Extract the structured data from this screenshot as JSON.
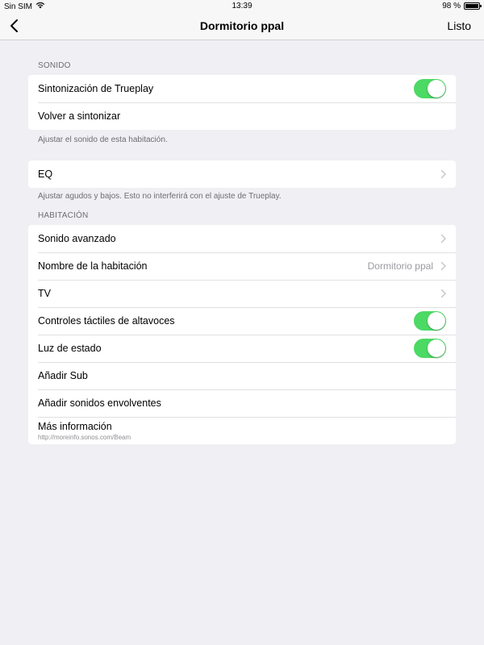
{
  "status_bar": {
    "carrier": "Sin SIM",
    "time": "13:39",
    "battery": "98 %",
    "battery_level": 0.98
  },
  "nav": {
    "title": "Dormitorio ppal",
    "done_label": "Listo"
  },
  "sound_section": {
    "header": "SONIDO",
    "trueplay_label": "Sintonización de Trueplay",
    "trueplay_on": true,
    "retune_label": "Volver a sintonizar",
    "footer": "Ajustar el sonido de esta habitación."
  },
  "eq_section": {
    "eq_label": "EQ",
    "footer": "Ajustar agudos y bajos. Esto no interferirá con el ajuste de Trueplay."
  },
  "room_section": {
    "header": "HABITACIÓN",
    "advanced_sound_label": "Sonido avanzado",
    "room_name_label": "Nombre de la habitación",
    "room_name_value": "Dormitorio ppal",
    "tv_label": "TV",
    "touch_controls_label": "Controles táctiles de altavoces",
    "touch_controls_on": true,
    "status_light_label": "Luz de estado",
    "status_light_on": true,
    "add_sub_label": "Añadir Sub",
    "add_surround_label": "Añadir sonidos envolventes",
    "more_info_label": "Más información",
    "more_info_url": "http://moreinfo.sonos.com/Beam"
  },
  "colors": {
    "toggle_on": "#4cd964",
    "background": "#efeff4",
    "secondary_text": "#6d6d72"
  }
}
